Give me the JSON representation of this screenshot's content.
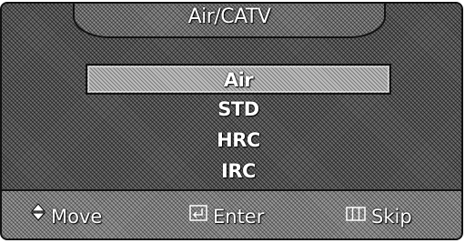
{
  "menu": {
    "title": "Air/CATV",
    "items": [
      {
        "label": "Air",
        "selected": true
      },
      {
        "label": "STD",
        "selected": false
      },
      {
        "label": "HRC",
        "selected": false
      },
      {
        "label": "IRC",
        "selected": false
      }
    ]
  },
  "footer": {
    "move": {
      "label": "Move",
      "icon": "up-down-arrows-icon"
    },
    "enter": {
      "label": "Enter",
      "icon": "enter-icon"
    },
    "skip": {
      "label": "Skip",
      "icon": "menu-icon"
    }
  }
}
